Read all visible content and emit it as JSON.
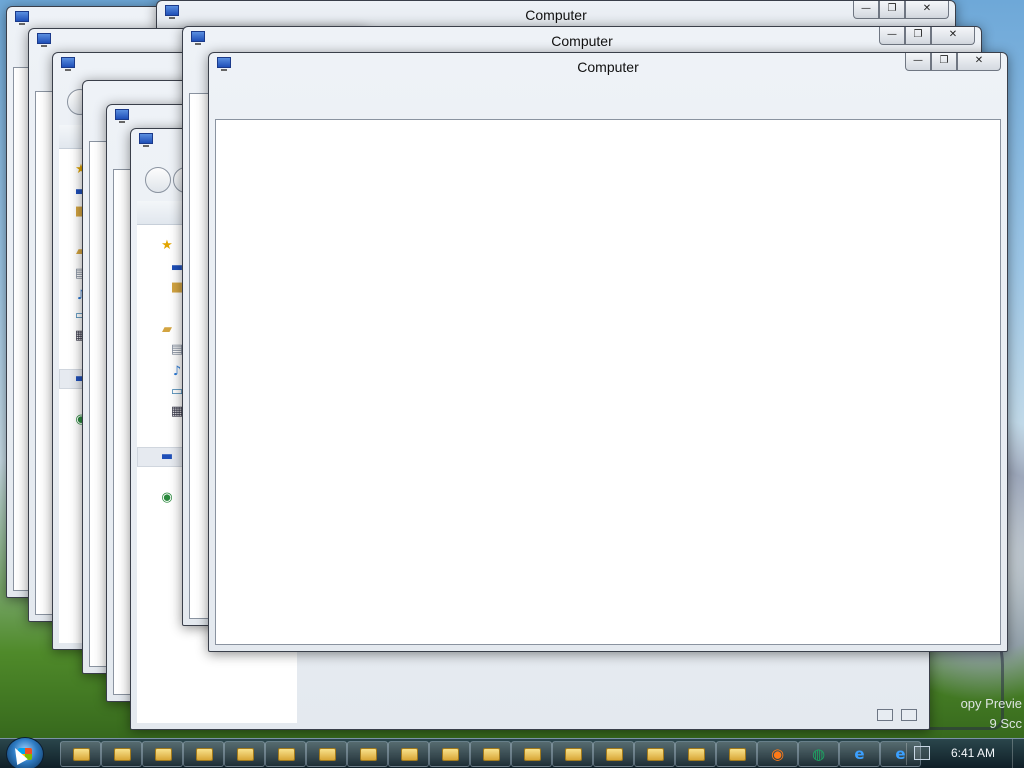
{
  "window_title": "Computer",
  "controls": {
    "minimize": "—",
    "maximize": "❐",
    "close": "✕"
  },
  "icons": {
    "favorites": "star-icon",
    "desktop": "desktop-icon",
    "downloads": "downloads-icon",
    "libraries": "libraries-icon",
    "documents": "documents-icon",
    "music": "music-icon",
    "pictures": "pictures-icon",
    "videos": "videos-icon",
    "computer": "computer-icon",
    "network": "network-icon"
  },
  "taskbar": {
    "explorer_buttons": 17,
    "pinned": [
      {
        "name": "firefox",
        "glyph": "◉"
      },
      {
        "name": "chrome",
        "glyph": "◍"
      },
      {
        "name": "internet-explorer-1",
        "glyph": "e"
      },
      {
        "name": "internet-explorer-2",
        "glyph": "e"
      }
    ],
    "clock": "6:41 AM"
  },
  "desktop_watermark": "opy Previe\n9 Scc",
  "colors": {
    "taskbar": "#1c3040",
    "accent": "#2d7ac2"
  }
}
